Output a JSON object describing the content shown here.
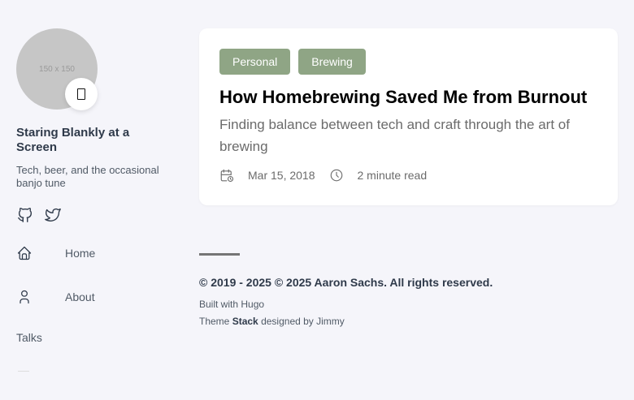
{
  "sidebar": {
    "avatar_text": "150 x 150",
    "site_name": "Staring Blankly at a Screen",
    "site_description": "Tech, beer, and the occasional banjo tune",
    "social": [
      {
        "icon": "github-icon"
      },
      {
        "icon": "twitter-icon"
      }
    ],
    "menu": [
      {
        "label": "Home",
        "icon": "home-icon"
      },
      {
        "label": "About",
        "icon": "user-icon"
      },
      {
        "label": "Talks"
      }
    ]
  },
  "article": {
    "tags": [
      "Personal",
      "Brewing"
    ],
    "title": "How Homebrewing Saved Me from Burnout",
    "subtitle": "Finding balance between tech and craft through the art of brewing",
    "date": "Mar 15, 2018",
    "reading_time": "2 minute read"
  },
  "footer": {
    "copyright": "© 2019 - 2025 © 2025 Aaron Sachs. All rights reserved.",
    "built_with": "Built with Hugo",
    "theme_prefix": "Theme",
    "theme_name": "Stack",
    "theme_suffix": "designed by Jimmy"
  },
  "colors": {
    "background": "#f5f5fa",
    "card": "#ffffff",
    "tag": "#8fa585",
    "text": "#2f3a4a"
  }
}
